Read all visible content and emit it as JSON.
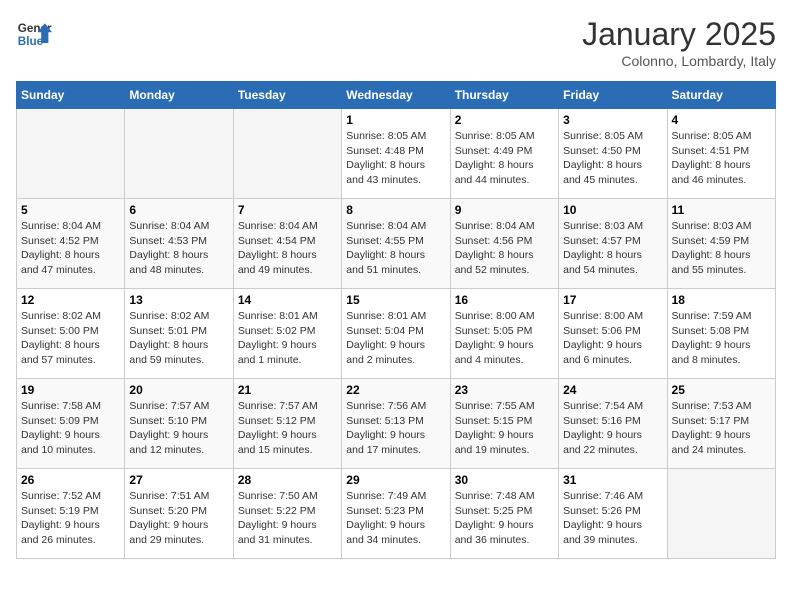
{
  "header": {
    "logo_line1": "General",
    "logo_line2": "Blue",
    "month": "January 2025",
    "location": "Colonno, Lombardy, Italy"
  },
  "weekdays": [
    "Sunday",
    "Monday",
    "Tuesday",
    "Wednesday",
    "Thursday",
    "Friday",
    "Saturday"
  ],
  "weeks": [
    [
      {
        "day": "",
        "info": ""
      },
      {
        "day": "",
        "info": ""
      },
      {
        "day": "",
        "info": ""
      },
      {
        "day": "1",
        "info": "Sunrise: 8:05 AM\nSunset: 4:48 PM\nDaylight: 8 hours\nand 43 minutes."
      },
      {
        "day": "2",
        "info": "Sunrise: 8:05 AM\nSunset: 4:49 PM\nDaylight: 8 hours\nand 44 minutes."
      },
      {
        "day": "3",
        "info": "Sunrise: 8:05 AM\nSunset: 4:50 PM\nDaylight: 8 hours\nand 45 minutes."
      },
      {
        "day": "4",
        "info": "Sunrise: 8:05 AM\nSunset: 4:51 PM\nDaylight: 8 hours\nand 46 minutes."
      }
    ],
    [
      {
        "day": "5",
        "info": "Sunrise: 8:04 AM\nSunset: 4:52 PM\nDaylight: 8 hours\nand 47 minutes."
      },
      {
        "day": "6",
        "info": "Sunrise: 8:04 AM\nSunset: 4:53 PM\nDaylight: 8 hours\nand 48 minutes."
      },
      {
        "day": "7",
        "info": "Sunrise: 8:04 AM\nSunset: 4:54 PM\nDaylight: 8 hours\nand 49 minutes."
      },
      {
        "day": "8",
        "info": "Sunrise: 8:04 AM\nSunset: 4:55 PM\nDaylight: 8 hours\nand 51 minutes."
      },
      {
        "day": "9",
        "info": "Sunrise: 8:04 AM\nSunset: 4:56 PM\nDaylight: 8 hours\nand 52 minutes."
      },
      {
        "day": "10",
        "info": "Sunrise: 8:03 AM\nSunset: 4:57 PM\nDaylight: 8 hours\nand 54 minutes."
      },
      {
        "day": "11",
        "info": "Sunrise: 8:03 AM\nSunset: 4:59 PM\nDaylight: 8 hours\nand 55 minutes."
      }
    ],
    [
      {
        "day": "12",
        "info": "Sunrise: 8:02 AM\nSunset: 5:00 PM\nDaylight: 8 hours\nand 57 minutes."
      },
      {
        "day": "13",
        "info": "Sunrise: 8:02 AM\nSunset: 5:01 PM\nDaylight: 8 hours\nand 59 minutes."
      },
      {
        "day": "14",
        "info": "Sunrise: 8:01 AM\nSunset: 5:02 PM\nDaylight: 9 hours\nand 1 minute."
      },
      {
        "day": "15",
        "info": "Sunrise: 8:01 AM\nSunset: 5:04 PM\nDaylight: 9 hours\nand 2 minutes."
      },
      {
        "day": "16",
        "info": "Sunrise: 8:00 AM\nSunset: 5:05 PM\nDaylight: 9 hours\nand 4 minutes."
      },
      {
        "day": "17",
        "info": "Sunrise: 8:00 AM\nSunset: 5:06 PM\nDaylight: 9 hours\nand 6 minutes."
      },
      {
        "day": "18",
        "info": "Sunrise: 7:59 AM\nSunset: 5:08 PM\nDaylight: 9 hours\nand 8 minutes."
      }
    ],
    [
      {
        "day": "19",
        "info": "Sunrise: 7:58 AM\nSunset: 5:09 PM\nDaylight: 9 hours\nand 10 minutes."
      },
      {
        "day": "20",
        "info": "Sunrise: 7:57 AM\nSunset: 5:10 PM\nDaylight: 9 hours\nand 12 minutes."
      },
      {
        "day": "21",
        "info": "Sunrise: 7:57 AM\nSunset: 5:12 PM\nDaylight: 9 hours\nand 15 minutes."
      },
      {
        "day": "22",
        "info": "Sunrise: 7:56 AM\nSunset: 5:13 PM\nDaylight: 9 hours\nand 17 minutes."
      },
      {
        "day": "23",
        "info": "Sunrise: 7:55 AM\nSunset: 5:15 PM\nDaylight: 9 hours\nand 19 minutes."
      },
      {
        "day": "24",
        "info": "Sunrise: 7:54 AM\nSunset: 5:16 PM\nDaylight: 9 hours\nand 22 minutes."
      },
      {
        "day": "25",
        "info": "Sunrise: 7:53 AM\nSunset: 5:17 PM\nDaylight: 9 hours\nand 24 minutes."
      }
    ],
    [
      {
        "day": "26",
        "info": "Sunrise: 7:52 AM\nSunset: 5:19 PM\nDaylight: 9 hours\nand 26 minutes."
      },
      {
        "day": "27",
        "info": "Sunrise: 7:51 AM\nSunset: 5:20 PM\nDaylight: 9 hours\nand 29 minutes."
      },
      {
        "day": "28",
        "info": "Sunrise: 7:50 AM\nSunset: 5:22 PM\nDaylight: 9 hours\nand 31 minutes."
      },
      {
        "day": "29",
        "info": "Sunrise: 7:49 AM\nSunset: 5:23 PM\nDaylight: 9 hours\nand 34 minutes."
      },
      {
        "day": "30",
        "info": "Sunrise: 7:48 AM\nSunset: 5:25 PM\nDaylight: 9 hours\nand 36 minutes."
      },
      {
        "day": "31",
        "info": "Sunrise: 7:46 AM\nSunset: 5:26 PM\nDaylight: 9 hours\nand 39 minutes."
      },
      {
        "day": "",
        "info": ""
      }
    ]
  ]
}
